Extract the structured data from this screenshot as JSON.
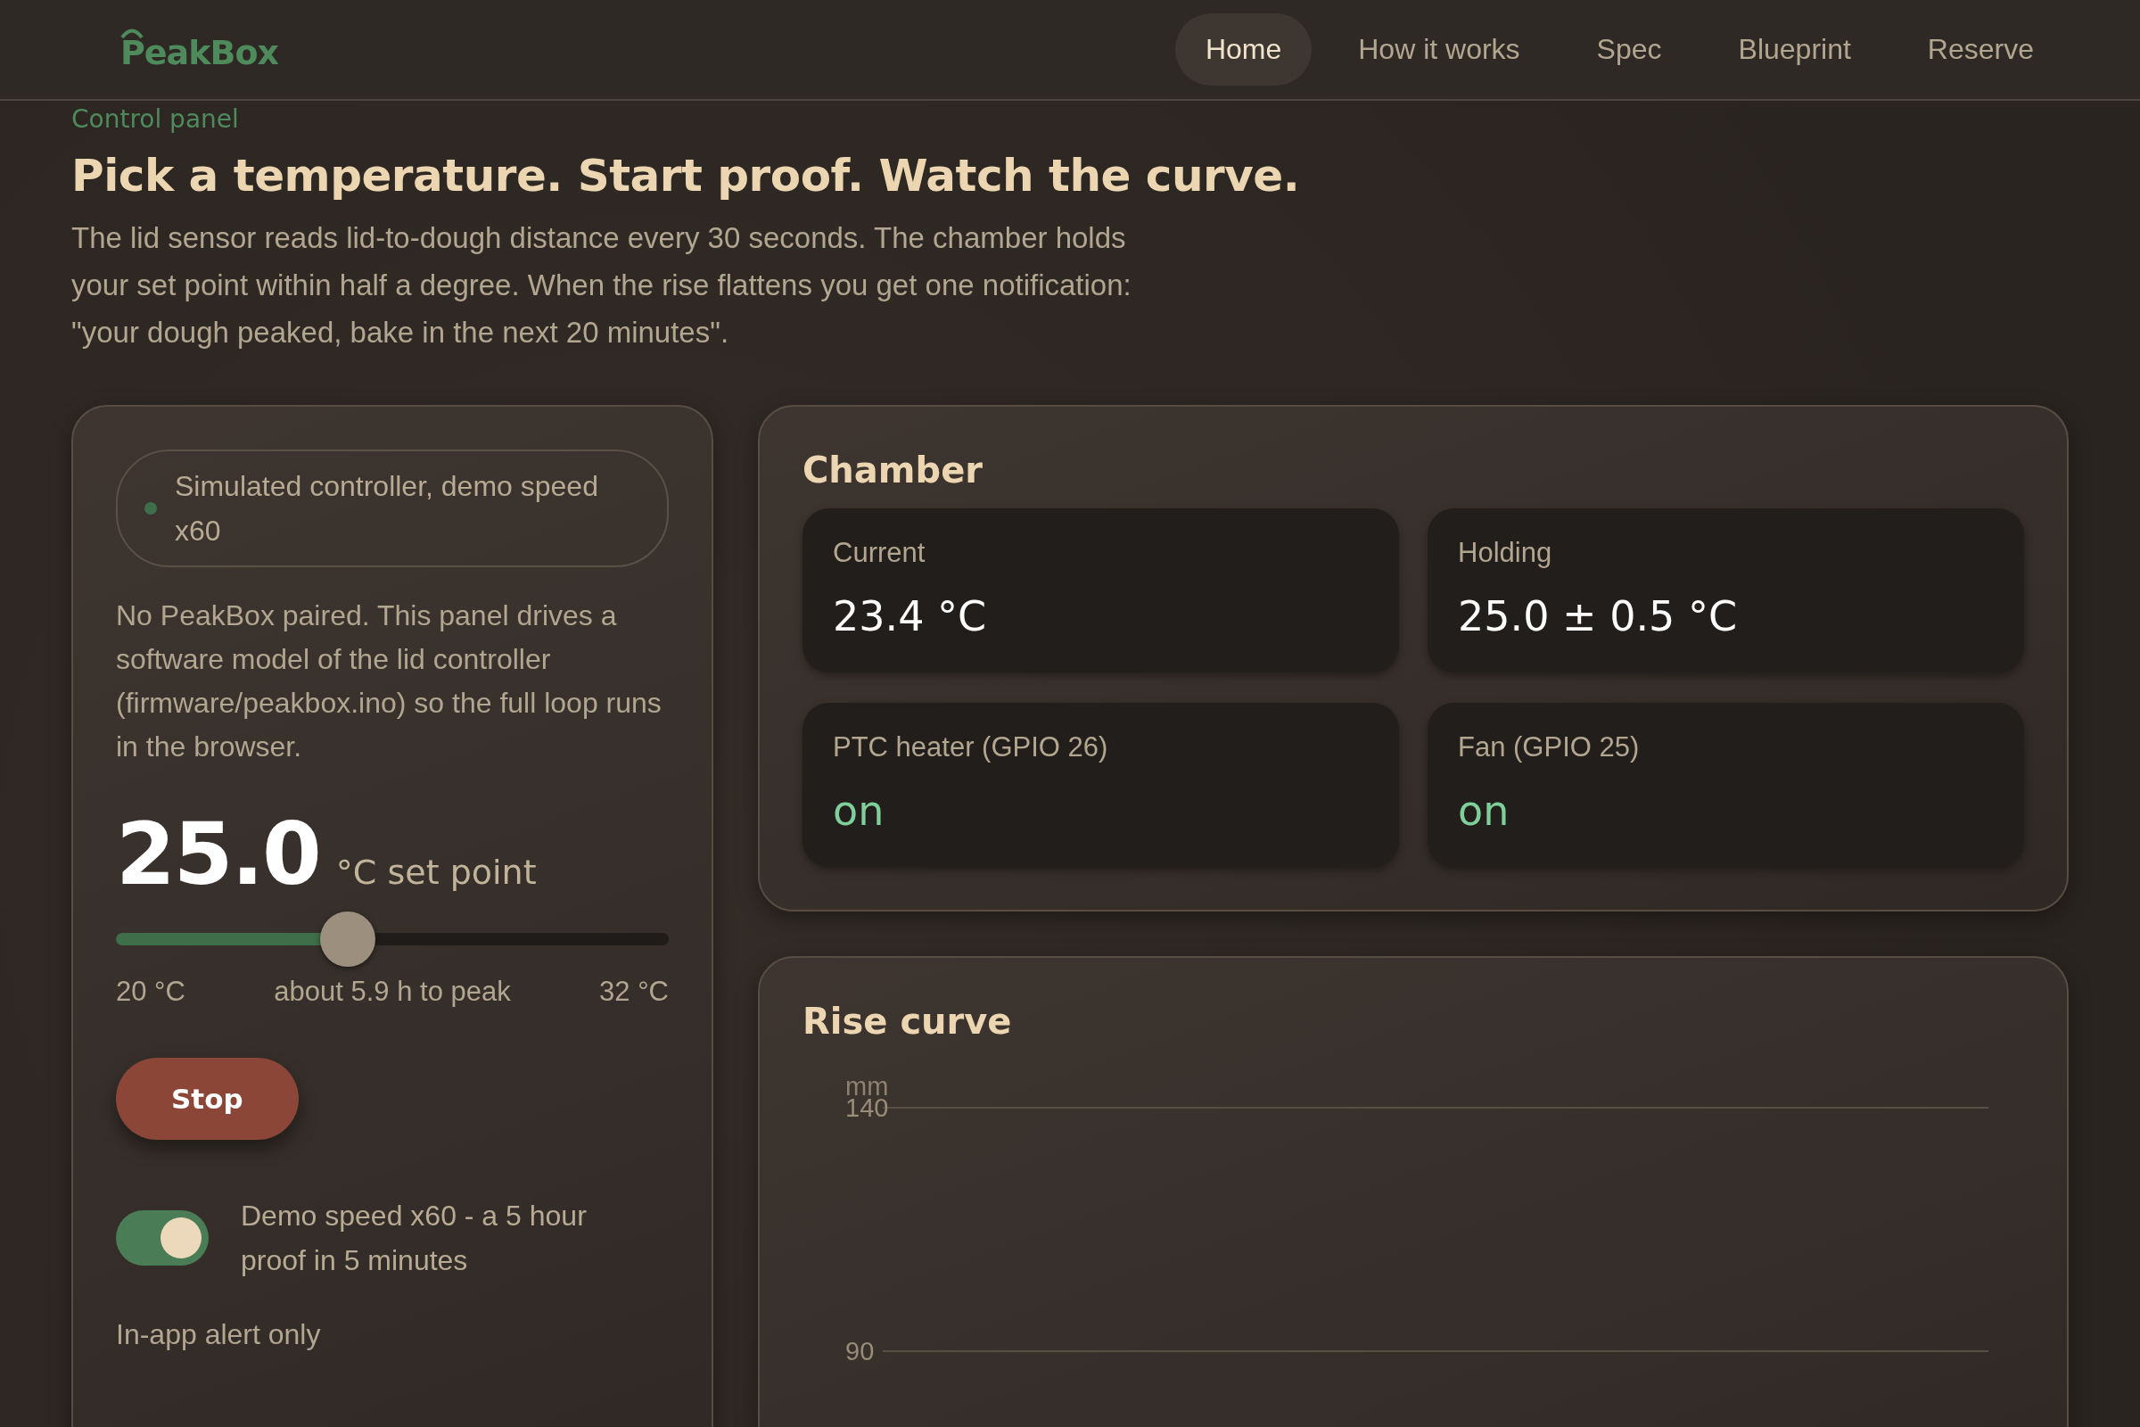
{
  "header": {
    "logo": "PeakBox",
    "nav": [
      {
        "label": "Home",
        "selected": true
      },
      {
        "label": "How it works",
        "selected": false
      },
      {
        "label": "Spec",
        "selected": false
      },
      {
        "label": "Blueprint",
        "selected": false
      },
      {
        "label": "Reserve",
        "selected": false
      }
    ]
  },
  "intro": {
    "eyebrow": "Control panel",
    "title": "Pick a temperature. Start proof. Watch the curve.",
    "text": "The lid sensor reads lid-to-dough distance every 30 seconds. The chamber holds your set point within half a degree. When the rise flattens you get one notification: \"your dough peaked, bake in the next 20 minutes\"."
  },
  "control": {
    "status": "Simulated controller, demo speed x60",
    "note": "No PeakBox paired. This panel drives a software model of the lid controller (firmware/peakbox.ino) so the full loop runs in the browser.",
    "setpoint": "25.0",
    "setpoint_unit": "°C set point",
    "slider": {
      "level": 0.42,
      "min_label": "20 °C",
      "hint": "about 5.9 h to peak",
      "max_label": "32 °C"
    },
    "button": "Stop",
    "toggle": {
      "on": true,
      "label": "Demo speed x60 - a 5 hour proof in 5 minutes"
    },
    "alert": "In-app alert only"
  },
  "chamber": {
    "title": "Chamber",
    "tiles": [
      {
        "label": "Current",
        "value": "23.4 °C",
        "kind": "reading"
      },
      {
        "label": "Holding",
        "value": "25.0 ± 0.5 °C",
        "kind": "reading"
      },
      {
        "label": "PTC heater (GPIO 26)",
        "value": "on",
        "kind": "state"
      },
      {
        "label": "Fan (GPIO 25)",
        "value": "on",
        "kind": "state"
      }
    ]
  },
  "rise_curve": {
    "title": "Rise curve",
    "axis_unit": "mm",
    "gridline_labels": [
      "140",
      "90"
    ]
  }
}
